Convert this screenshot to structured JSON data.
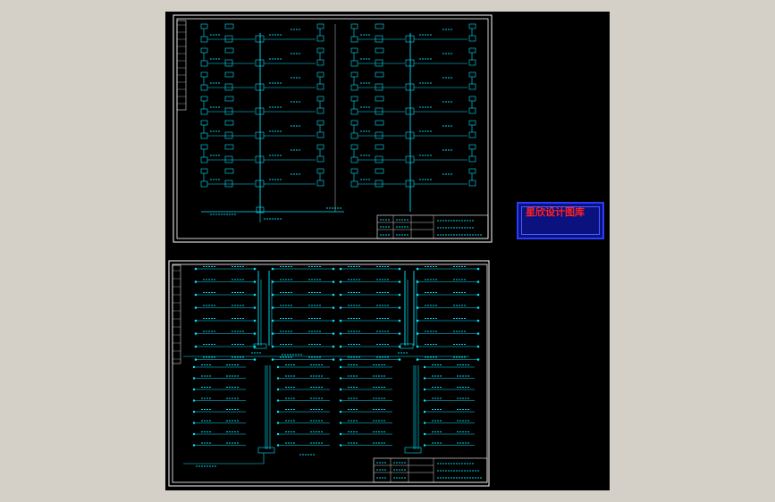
{
  "viewport": {
    "background": "#d4d0c8",
    "canvas_background": "#000000",
    "line_color": "#00e5ff",
    "frame_color": "#ffffff"
  },
  "sheet_top": {
    "title_block": {
      "drawing_name": "",
      "drawing_no": ""
    }
  },
  "sheet_bottom": {
    "title_block": {
      "drawing_name": "",
      "drawing_no": ""
    }
  },
  "watermark": {
    "title": "星欣设计图库",
    "subtitle": "",
    "qq": "",
    "url": "",
    "mail": "",
    "text_color": "#ff2020",
    "box_color": "#0a1280"
  }
}
